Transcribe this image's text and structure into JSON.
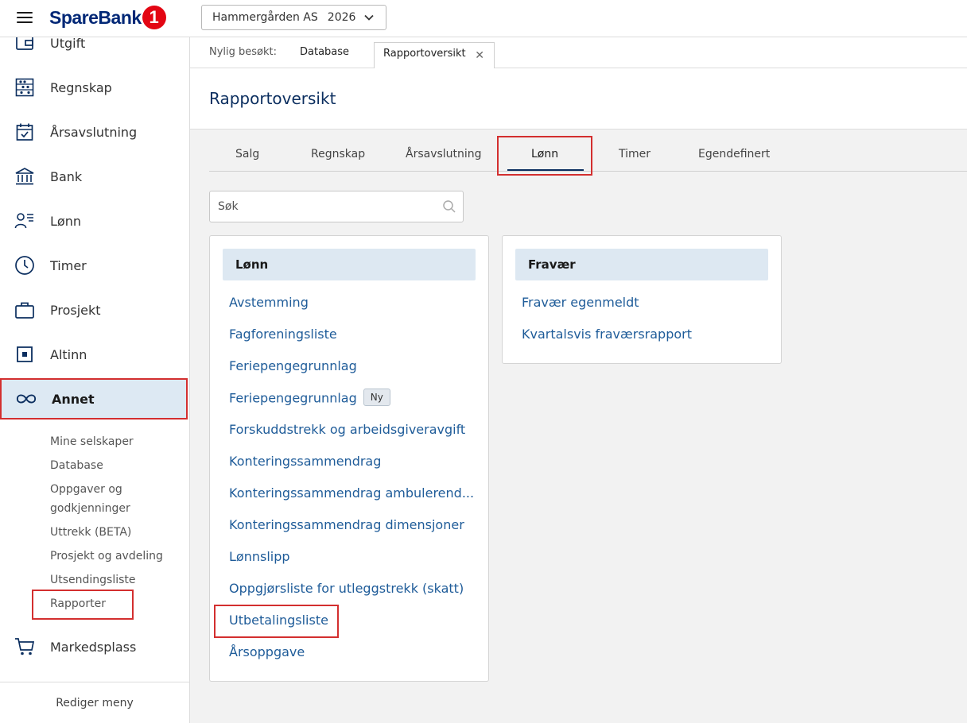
{
  "header": {
    "brand_text": "SpareBank",
    "brand_badge": "1",
    "company": "Hammergården AS",
    "year": "2026"
  },
  "sidebar": {
    "items": [
      {
        "label": "Utgift",
        "icon": "wallet-icon"
      },
      {
        "label": "Regnskap",
        "icon": "abacus-icon"
      },
      {
        "label": "Årsavslutning",
        "icon": "calendar-check-icon"
      },
      {
        "label": "Bank",
        "icon": "bank-icon"
      },
      {
        "label": "Lønn",
        "icon": "person-list-icon"
      },
      {
        "label": "Timer",
        "icon": "clock-icon"
      },
      {
        "label": "Prosjekt",
        "icon": "briefcase-icon"
      },
      {
        "label": "Altinn",
        "icon": "altinn-icon"
      },
      {
        "label": "Annet",
        "icon": "infinity-icon"
      },
      {
        "label": "Markedsplass",
        "icon": "cart-icon"
      }
    ],
    "subitems": [
      "Mine selskaper",
      "Database",
      "Oppgaver og",
      "godkjenninger",
      "Uttrekk (BETA)",
      "Prosjekt og avdeling",
      "Utsendingsliste",
      "Rapporter"
    ],
    "footer": "Rediger meny"
  },
  "recent": {
    "label": "Nylig besøkt:",
    "link": "Database",
    "open_tab": "Rapportoversikt"
  },
  "page": {
    "title": "Rapportoversikt"
  },
  "tabs": [
    "Salg",
    "Regnskap",
    "Årsavslutning",
    "Lønn",
    "Timer",
    "Egendefinert"
  ],
  "search": {
    "placeholder": "Søk"
  },
  "cards": [
    {
      "title": "Lønn",
      "links": [
        "Avstemming",
        "Fagforeningsliste",
        "Feriepengegrunnlag",
        "Feriepengegrunnlag",
        "Forskuddstrekk og arbeidsgiveravgift",
        "Konteringssammendrag",
        "Konteringssammendrag ambulerend...",
        "Konteringssammendrag dimensjoner",
        "Lønnslipp",
        "Oppgjørsliste for utleggstrekk (skatt)",
        "Utbetalingsliste",
        "Årsoppgave"
      ],
      "new_badge": "Ny"
    },
    {
      "title": "Fravær",
      "links": [
        "Fravær egenmeldt",
        "Kvartalsvis fraværsrapport"
      ]
    }
  ],
  "colors": {
    "brand_navy": "#002776",
    "brand_red": "#e30613",
    "link_blue": "#1f5c99",
    "highlight_red": "#d32f2f",
    "active_bg": "#dde9f3"
  }
}
